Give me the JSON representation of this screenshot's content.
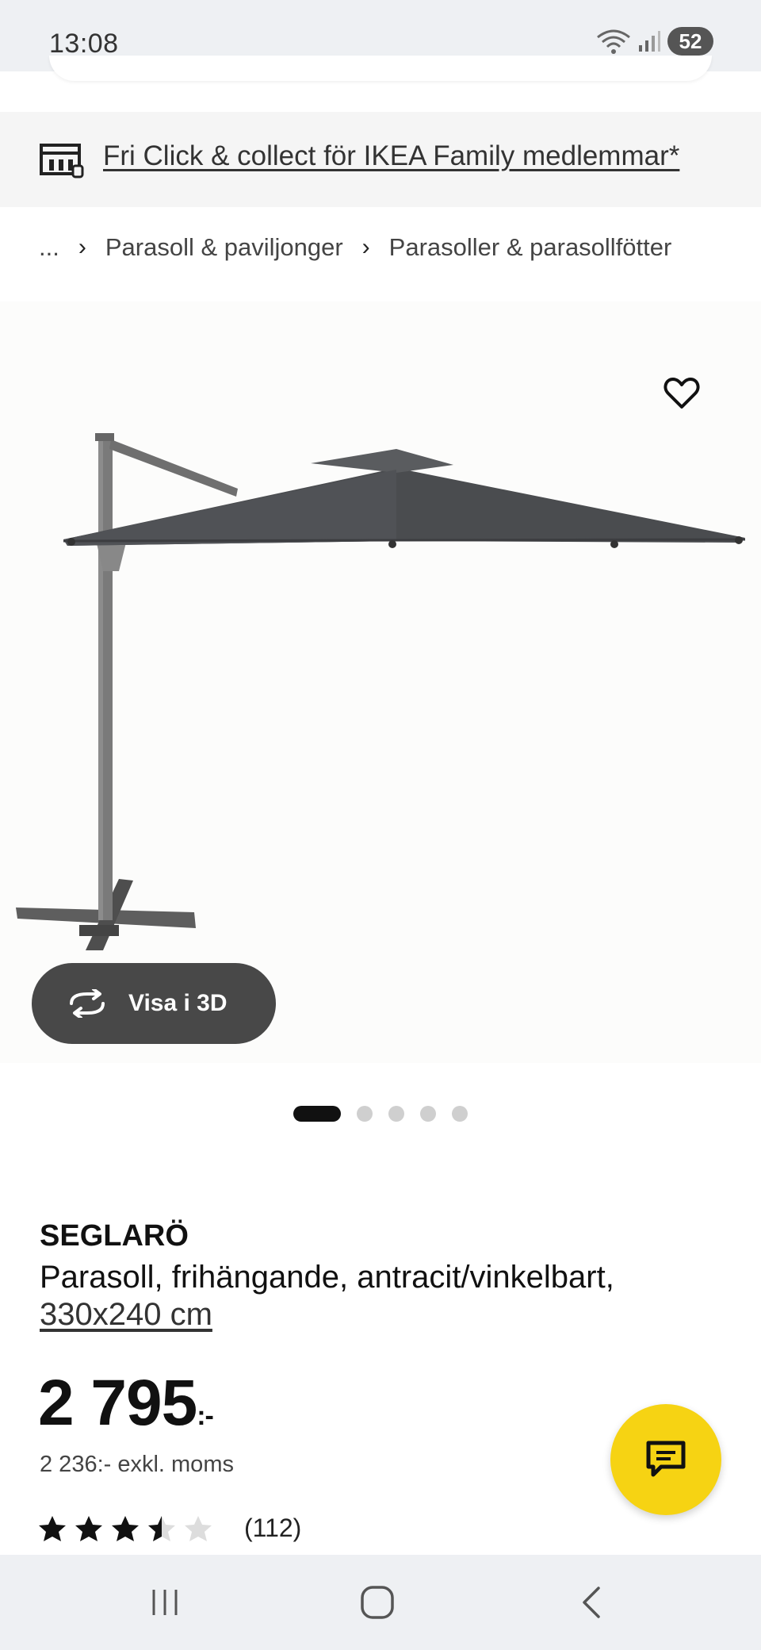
{
  "status_bar": {
    "time": "13:08",
    "battery": "52"
  },
  "promo": {
    "text": "Fri Click & collect för IKEA Family medlemmar*"
  },
  "breadcrumb": {
    "ellipsis": "...",
    "items": [
      "Parasoll & paviljonger",
      "Parasoller & parasollfötter"
    ]
  },
  "gallery": {
    "view_3d_label": "Visa i 3D",
    "image_count": 5,
    "active_index": 0
  },
  "product": {
    "name": "SEGLARÖ",
    "description": "Parasoll, frihängande, antracit/vinkelbart,",
    "size": "330x240 cm",
    "price": "2 795",
    "price_suffix": ":-",
    "price_excl_vat": "2 236:- exkl. moms",
    "rating": 3.5,
    "rating_max": 5,
    "review_count": "(112)"
  },
  "icons": {
    "promo": "store-collect-icon",
    "favorite": "heart-icon",
    "view_3d": "rotate-3d-icon",
    "chat": "chat-bubble-icon",
    "nav": [
      "recent-apps-icon",
      "home-icon",
      "back-icon"
    ]
  },
  "colors": {
    "chat_fab": "#f6d313",
    "view_3d_button": "#484848",
    "star_filled": "#111111",
    "star_empty": "#dddddd"
  }
}
